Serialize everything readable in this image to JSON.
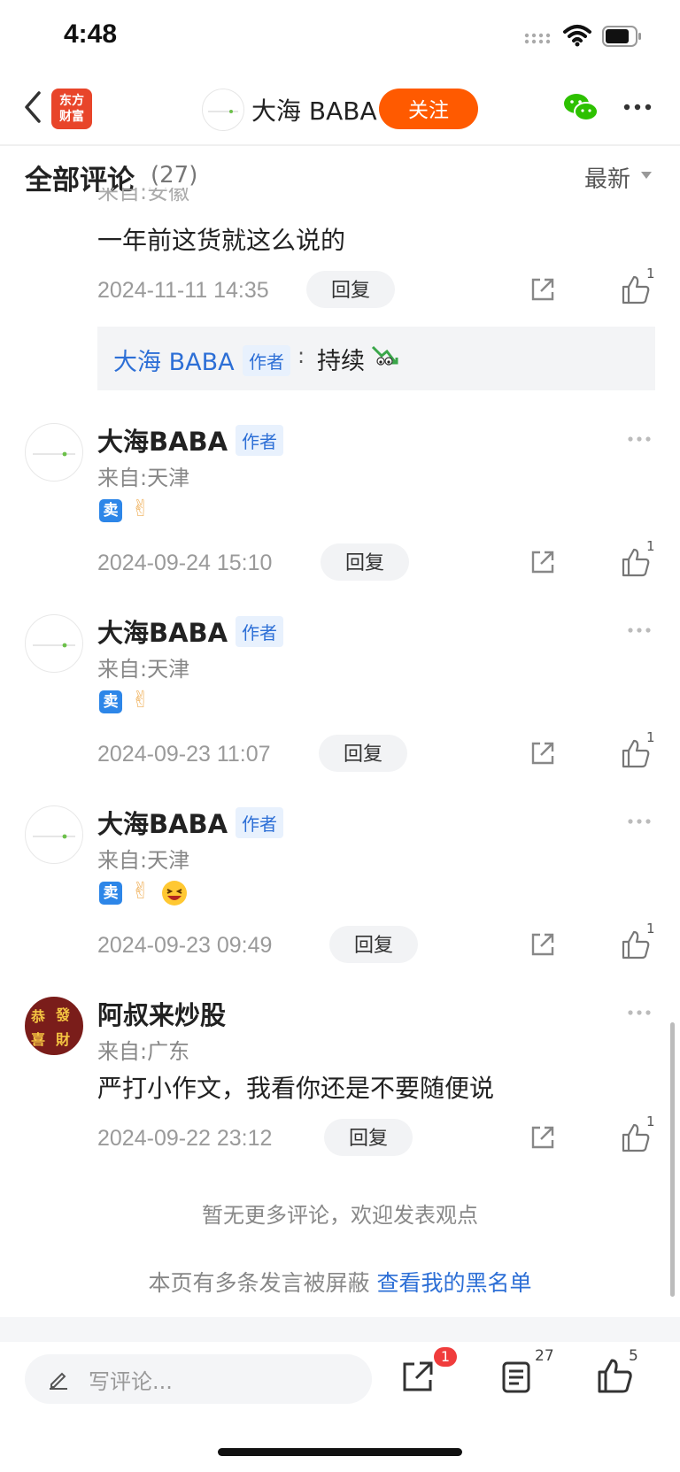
{
  "status_bar": {
    "time": "4:48"
  },
  "nav": {
    "logo_text_line1": "东方",
    "logo_text_line2": "财富",
    "author_name": "大海 BABA",
    "follow_label": "关注"
  },
  "comments_header": {
    "title": "全部评论",
    "count": "(27)",
    "sort_label": "最新"
  },
  "top_comment": {
    "partial_from": "来自:安徽",
    "text": "一年前这货就这么说的",
    "date": "2024-11-11 14:35",
    "reply_label": "回复",
    "like_count": "1",
    "sub_reply": {
      "name": "大海 BABA",
      "badge": "作者",
      "colon": ":",
      "text": "持续"
    }
  },
  "comments": [
    {
      "name": "大海BABA",
      "badge": "作者",
      "from": "来自:天津",
      "emoji": [
        "卖",
        "✌"
      ],
      "date": "2024-09-24 15:10",
      "reply_label": "回复",
      "like_count": "1"
    },
    {
      "name": "大海BABA",
      "badge": "作者",
      "from": "来自:天津",
      "emoji": [
        "卖",
        "✌"
      ],
      "date": "2024-09-23 11:07",
      "reply_label": "回复",
      "like_count": "1"
    },
    {
      "name": "大海BABA",
      "badge": "作者",
      "from": "来自:天津",
      "emoji": [
        "卖",
        "✌",
        "😆"
      ],
      "date": "2024-09-23 09:49",
      "reply_label": "回复",
      "like_count": "1"
    },
    {
      "name": "阿叔来炒股",
      "from": "来自:广东",
      "text": "严打小作文，我看你还是不要随便说",
      "date": "2024-09-22 23:12",
      "reply_label": "回复",
      "like_count": "1",
      "avatar_text": [
        "恭",
        "發",
        "喜",
        "財"
      ]
    }
  ],
  "footer": {
    "no_more": "暂无更多评论，欢迎发表观点",
    "blocked_prefix": "本页有多条发言被屏蔽",
    "blocked_link": "查看我的黑名单"
  },
  "bottom_bar": {
    "input_placeholder": "写评论...",
    "share_badge": "1",
    "comment_count": "27",
    "like_count": "5"
  },
  "colors": {
    "accent": "#ff5a00",
    "link": "#2d6fd6",
    "brand_red": "#e8452a"
  }
}
